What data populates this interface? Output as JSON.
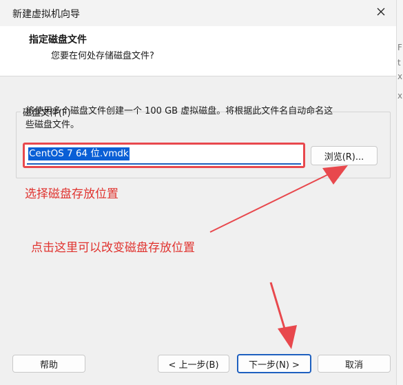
{
  "window": {
    "title": "新建虚拟机向导",
    "close_glyph": "✕"
  },
  "header": {
    "title": "指定磁盘文件",
    "subtitle": "您要在何处存储磁盘文件?"
  },
  "disk_file": {
    "group_label": "磁盘文件(F)",
    "description_line1": "将使用多个磁盘文件创建一个 100 GB 虚拟磁盘。将根据此文件名自动命名这",
    "description_line2": "些磁盘文件。",
    "filename_value": "CentOS 7 64 位.vmdk",
    "browse_label": "浏览(R)..."
  },
  "annotations": {
    "note1": "选择磁盘存放位置",
    "note2": "点击这里可以改变磁盘存放位置",
    "color": "#e0332f"
  },
  "footer": {
    "help_label": "帮助",
    "back_label": "< 上一步(B)",
    "next_label": "下一步(N) >",
    "cancel_label": "取消"
  },
  "right_strip_chars": [
    "F",
    "t",
    "x",
    "x"
  ]
}
